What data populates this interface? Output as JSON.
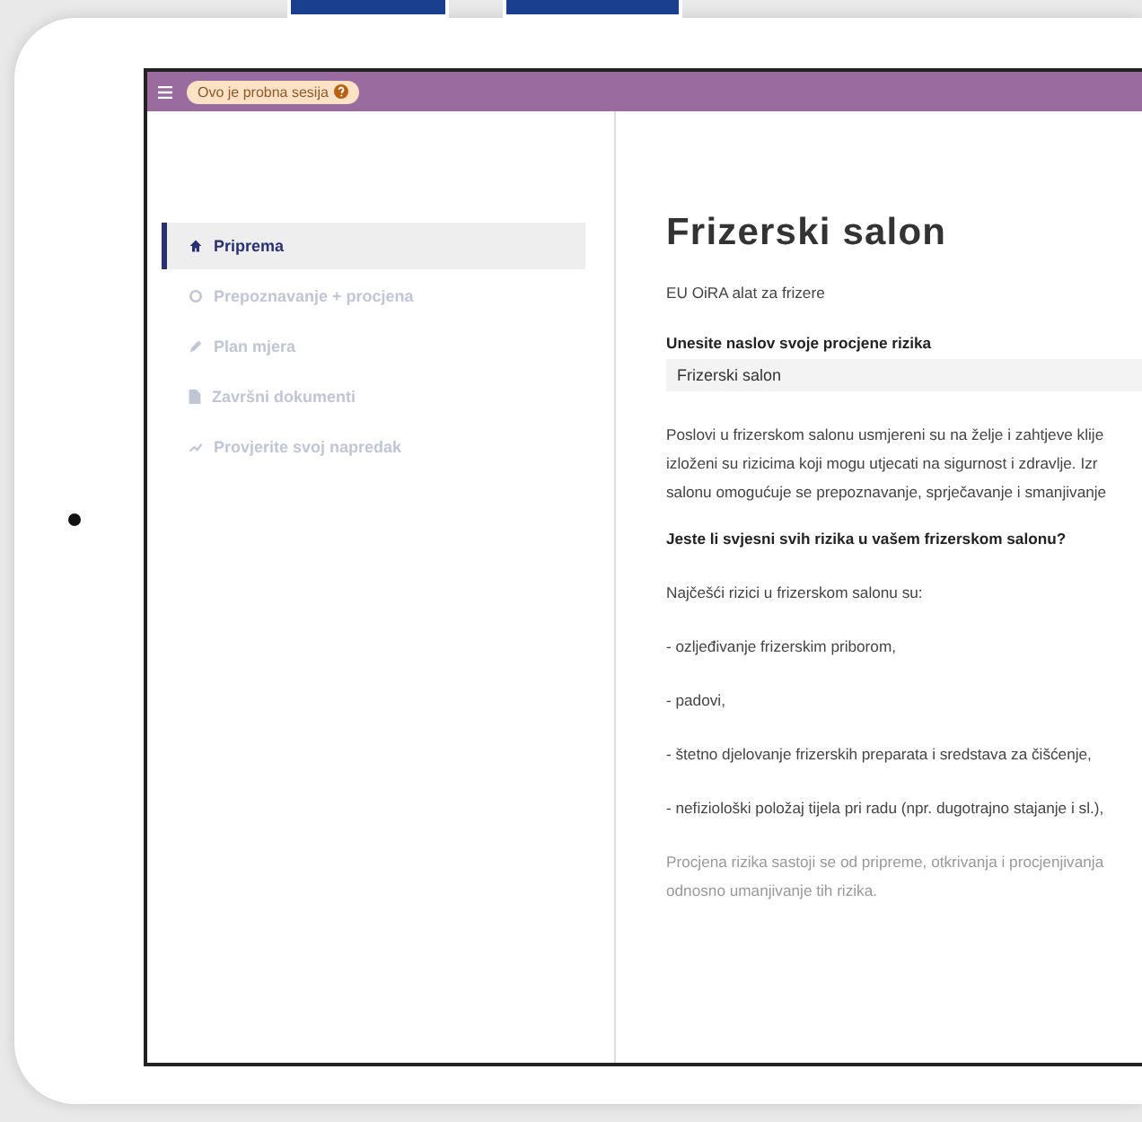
{
  "header": {
    "badge": "Ovo je probna sesija"
  },
  "sidebar": {
    "items": [
      {
        "label": "Priprema",
        "selected": true,
        "disabled": false
      },
      {
        "label": "Prepoznavanje + procjena",
        "selected": false,
        "disabled": true
      },
      {
        "label": "Plan mjera",
        "selected": false,
        "disabled": true
      },
      {
        "label": "Završni dokumenti",
        "selected": false,
        "disabled": true
      },
      {
        "label": "Provjerite svoj napredak",
        "selected": false,
        "disabled": true
      }
    ]
  },
  "main": {
    "title": "Frizerski salon",
    "subtitle": "EU OiRA alat za frizere",
    "field": {
      "label": "Unesite naslov svoje procjene rizika",
      "value": "Frizerski salon"
    },
    "intro": [
      "Poslovi u frizerskom salonu usmjereni su na želje i zahtjeve klije",
      "izloženi su rizicima koji mogu utjecati na sigurnost i zdravlje. Izr",
      "salonu omogućuje se prepoznavanje, sprječavanje i smanjivanje"
    ],
    "question": "Jeste li svjesni svih rizika u vašem frizerskom salonu?",
    "paragraphs": [
      "Najčešći rizici u frizerskom salonu su:",
      "- ozljeđivanje frizerskim priborom,",
      "- padovi,",
      "- štetno djelovanje frizerskih preparata i sredstava za čišćenje,",
      "- nefiziološki položaj tijela pri radu (npr. dugotrajno stajanje i sl.),"
    ],
    "closing": [
      "Procjena rizika sastoji se od pripreme, otkrivanja i procjenjivanja",
      "odnosno umanjivanje tih rizika."
    ]
  }
}
